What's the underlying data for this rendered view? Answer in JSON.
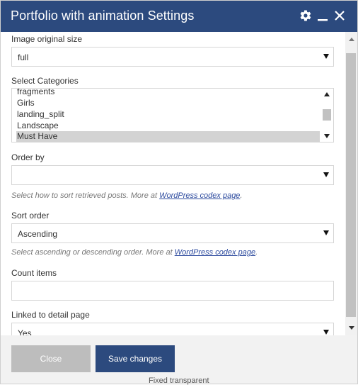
{
  "dialog": {
    "title": "Portfolio with animation Settings",
    "icons": [
      "gear-icon",
      "minimize-icon",
      "close-icon"
    ]
  },
  "fields": {
    "image_size": {
      "label": "Image original size",
      "value": "full"
    },
    "categories": {
      "label": "Select Categories",
      "items": [
        "fragments",
        "Girls",
        "landing_split",
        "Landscape",
        "Must Have"
      ],
      "selected": "Must Have"
    },
    "order_by": {
      "label": "Order by",
      "value": "",
      "hint_text": "Select how to sort retrieved posts. More at ",
      "hint_link": "WordPress codex page",
      "hint_end": "."
    },
    "sort_order": {
      "label": "Sort order",
      "value": "Ascending",
      "hint_text": "Select ascending or descending order. More at ",
      "hint_link": "WordPress codex page",
      "hint_end": "."
    },
    "count_items": {
      "label": "Count items",
      "value": ""
    },
    "linked_detail": {
      "label": "Linked to detail page",
      "value": "Yes"
    }
  },
  "footer": {
    "close_label": "Close",
    "save_label": "Save changes"
  },
  "background_text": "Fixed transparent",
  "colors": {
    "header": "#2c4a7e",
    "save_button": "#2c4a7e",
    "close_button": "#bdbdbd",
    "link": "#2c4a9e"
  }
}
